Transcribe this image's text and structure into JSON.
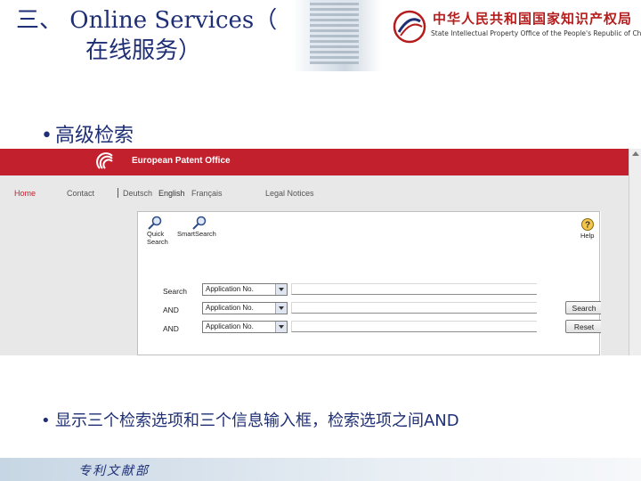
{
  "slide": {
    "title_line1": "三、 Online Services（",
    "title_line2": "在线服务）",
    "logo_cn": "中华人民共和国国家知识产权局",
    "logo_en": "State Intellectual Property Office of the People's Republic of China",
    "bullet1": "高级检索",
    "bullet2": "显示三个检索选项和三个信息输入框，检索选项之间AND",
    "bullet_char": "•",
    "footer": "专利文献部",
    "colors": {
      "title": "#1e2f75",
      "epo_red": "#c3202d",
      "logo_red": "#b51d1d"
    }
  },
  "epo": {
    "name": "European Patent Office",
    "nav": {
      "home": "Home",
      "contact": "Contact",
      "deutsch": "Deutsch",
      "english": "English",
      "francais": "Français",
      "legal": "Legal Notices"
    },
    "toolbar": {
      "quick_search": "Quick\nSearch",
      "smart_search": "SmartSearch",
      "help": "Help",
      "icons": [
        "magnifier-icon",
        "magnifier-icon",
        "help-icon"
      ]
    },
    "rows": [
      {
        "label": "Search",
        "select": "Application No.",
        "input": "",
        "button": ""
      },
      {
        "label": "AND",
        "select": "Application No.",
        "input": "",
        "button": "Search"
      },
      {
        "label": "AND",
        "select": "Application No.",
        "input": "",
        "button": "Reset"
      }
    ]
  }
}
